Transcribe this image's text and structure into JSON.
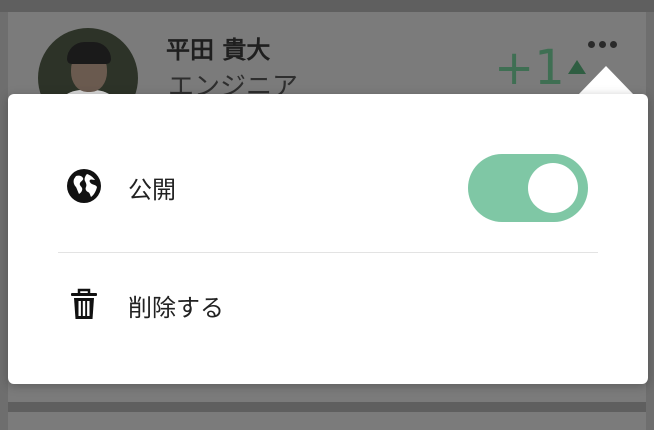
{
  "profile": {
    "name": "平田 貴大",
    "role": "エンジニア",
    "score": "+1"
  },
  "menu": {
    "public_label": "公開",
    "public_enabled": true,
    "delete_label": "削除する"
  },
  "colors": {
    "toggle_on": "#7fc7a5",
    "score_green": "#3f6f53",
    "overlay_gray": "#7b7b7b"
  },
  "icons": {
    "public": "globe-icon",
    "delete": "trash-icon",
    "more": "more-dots-icon"
  }
}
